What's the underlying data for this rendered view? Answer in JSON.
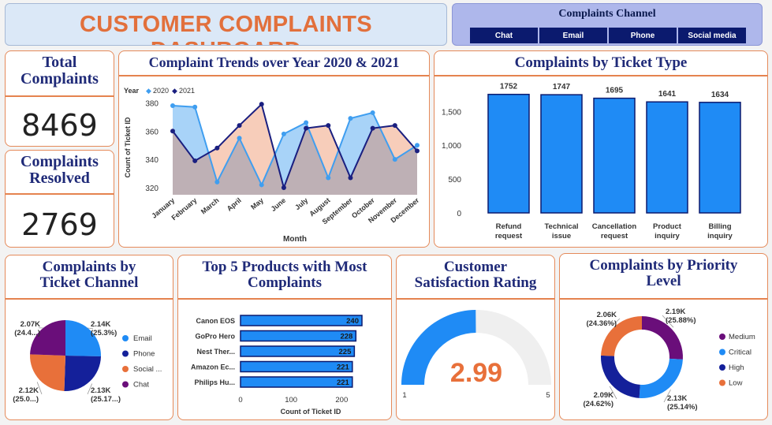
{
  "header": {
    "title": "CUSTOMER COMPLAINTS DASHBOARD"
  },
  "channel_slicer": {
    "title": "Complaints Channel",
    "options": [
      "Chat",
      "Email",
      "Phone",
      "Social media"
    ]
  },
  "kpis": {
    "total": {
      "label_line1": "Total",
      "label_line2": "Complaints",
      "value": "8469"
    },
    "resolved": {
      "label_line1": "Complaints",
      "label_line2": "Resolved",
      "value": "2769"
    }
  },
  "colors": {
    "c2020": "#3f9ef0",
    "c2021": "#1a1f80",
    "bar": "#1f8bf5",
    "orange": "#e8703a",
    "purple": "#6a0e7a",
    "navy": "#14209a"
  },
  "chart_data": [
    {
      "type": "area",
      "title": "Complaint Trends over Year 2020 & 2021",
      "legend_label": "Year",
      "categories": [
        "January",
        "February",
        "March",
        "April",
        "May",
        "June",
        "July",
        "August",
        "September",
        "October",
        "November",
        "December"
      ],
      "series": [
        {
          "name": "2020",
          "values": [
            378,
            377,
            324,
            355,
            322,
            358,
            366,
            327,
            369,
            373,
            340,
            350
          ]
        },
        {
          "name": "2021",
          "values": [
            360,
            339,
            348,
            364,
            379,
            320,
            362,
            364,
            327,
            362,
            364,
            346
          ]
        }
      ],
      "xlabel": "Month",
      "ylabel": "Count of Ticket ID",
      "yticks": [
        320,
        340,
        360,
        380
      ],
      "ylim": [
        315,
        383
      ]
    },
    {
      "type": "bar",
      "title": "Complaints by Ticket Type",
      "categories": [
        [
          "Refund",
          "request"
        ],
        [
          "Technical",
          "issue"
        ],
        [
          "Cancellation",
          "request"
        ],
        [
          "Product",
          "inquiry"
        ],
        [
          "Billing",
          "inquiry"
        ]
      ],
      "values": [
        1752,
        1747,
        1695,
        1641,
        1634
      ],
      "data_labels": [
        "1752",
        "1747",
        "1695",
        "1641",
        "1634"
      ],
      "yticks": [
        "0",
        "500",
        "1,000",
        "1,500"
      ],
      "ylim": [
        0,
        1900
      ]
    },
    {
      "type": "pie",
      "title_line1": "Complaints by",
      "title_line2": "Ticket Channel",
      "slices": [
        {
          "name": "Email",
          "value": 25.3,
          "label1": "2.14K",
          "label2": "(25.3%)",
          "color": "#1f8bf5"
        },
        {
          "name": "Phone",
          "value": 25.17,
          "label1": "2.13K",
          "label2": "(25.17...)",
          "color": "#14209a"
        },
        {
          "name": "Social ...",
          "value": 25.0,
          "label1": "2.12K",
          "label2": "(25.0...)",
          "color": "#e8703a"
        },
        {
          "name": "Chat",
          "value": 24.4,
          "label1": "2.07K",
          "label2": "(24.4...)",
          "color": "#6a0e7a"
        }
      ]
    },
    {
      "type": "bar",
      "orientation": "horizontal",
      "title_line1": "Top 5 Products with Most",
      "title_line2": "Complaints",
      "categories": [
        "Canon EOS",
        "GoPro Hero",
        "Nest Ther...",
        "Amazon Ec...",
        "Philips Hu..."
      ],
      "values": [
        240,
        228,
        225,
        221,
        221
      ],
      "xticks": [
        0,
        100,
        200
      ],
      "xlim": [
        0,
        240
      ],
      "xlabel": "Count of Ticket ID"
    },
    {
      "type": "gauge",
      "title_line1": "Customer",
      "title_line2": "Satisfaction Rating",
      "value": 2.99,
      "display": "2.99",
      "min": 1,
      "max": 5,
      "min_label": "1",
      "max_label": "5"
    },
    {
      "type": "pie",
      "donut": true,
      "title_line1": "Complaints by Priority",
      "title_line2": "Level",
      "slices": [
        {
          "name": "Medium",
          "value": 25.88,
          "label1": "2.19K",
          "label2": "(25.88%)",
          "color": "#6a0e7a"
        },
        {
          "name": "Critical",
          "value": 25.14,
          "label1": "2.13K",
          "label2": "(25.14%)",
          "color": "#1f8bf5"
        },
        {
          "name": "High",
          "value": 24.62,
          "label1": "2.09K",
          "label2": "(24.62%)",
          "color": "#14209a"
        },
        {
          "name": "Low",
          "value": 24.36,
          "label1": "2.06K",
          "label2": "(24.36%)",
          "color": "#e8703a"
        }
      ]
    }
  ]
}
